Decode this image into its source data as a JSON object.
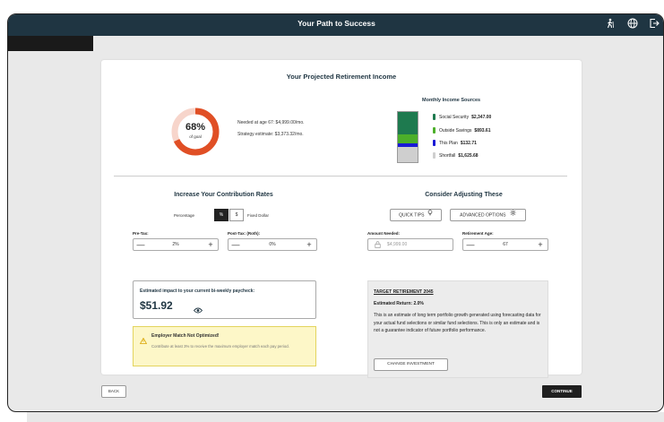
{
  "header": {
    "title": "Your Path to Success"
  },
  "income": {
    "heading": "Your Projected Retirement Income",
    "progress": {
      "percent_text": "68%",
      "percent_value": 68,
      "sub": "of goal"
    },
    "needed_text": "Needed at age 67:  $4,999.00/mo.",
    "strategy_text": "Strategy estimate: $3,373.32/mo.",
    "sources_heading": "Monthly Income Sources",
    "sources": [
      {
        "label": "Social Security",
        "value": "$2,347.00",
        "color": "#1e7a4f"
      },
      {
        "label": "Outside Savings",
        "value": "$893.61",
        "color": "#4caf2a"
      },
      {
        "label": "This Plan",
        "value": "$132.71",
        "color": "#1a1ad6"
      },
      {
        "label": "Shortfall",
        "value": "$1,625.68",
        "color": "#cfcfcf"
      }
    ]
  },
  "contribution": {
    "heading": "Increase Your Contribution Rates",
    "toggle_left": "Percentage",
    "toggle_pct": "%",
    "toggle_dollar": "$",
    "toggle_right": "Fixed Dollar",
    "pretax_label": "Pre-Tax:",
    "pretax_value": "2%",
    "posttax_label": "Post-Tax: (Roth):",
    "posttax_value": "0%",
    "minus": "—",
    "plus": "+",
    "impact_label": "Estimated impact to your current bi-weekly paycheck:",
    "impact_value": "$51.92",
    "match_title": "Employer Match Not Optimized!",
    "match_body": "Contribute at least 3% to receive the maximum employer match each pay period."
  },
  "adjust": {
    "heading": "Consider Adjusting These",
    "quick_tips": "QUICK TIPS",
    "advanced": "ADVANCED OPTIONS",
    "amount_label": "Amount Needed:",
    "amount_placeholder": "$4,999.00",
    "age_label": "Retirement Age:",
    "age_value": "67",
    "target_title": "TARGET RETIREMENT 2045",
    "target_return": "Estimated Return: 2.0%",
    "target_body": "This is an estimate of long term portfolio growth generated using forecasting data for your actual fund selections or similar fund selections. This is only an estimate and is not a guarantee indicator of future portfolio performance.",
    "change_btn": "CHANGE INVESTMENT"
  },
  "footer": {
    "back": "BACK",
    "continue": "CONTINUE"
  },
  "icons": [
    "hiker-icon",
    "globe-icon",
    "logout-icon",
    "eye-icon",
    "lightbulb-icon",
    "gear-icon",
    "lock-icon",
    "warning-icon"
  ]
}
